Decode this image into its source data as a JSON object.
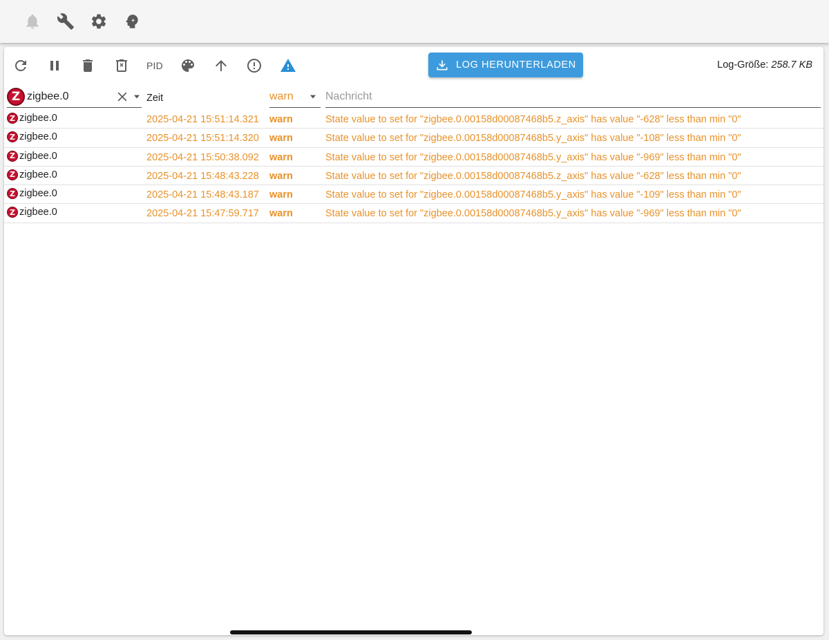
{
  "topbar": {
    "icons": [
      "bell-icon",
      "wrench-icon",
      "gear-icon",
      "head-icon"
    ]
  },
  "toolbar": {
    "pid_label": "PID",
    "download_label": "LOG HERUNTERLADEN",
    "logsize_label": "Log-Größe:",
    "logsize_value": "258.7 KB",
    "accent_color": "#3d9bdd"
  },
  "filters": {
    "source_value": "zigbee.0",
    "time_label": "Zeit",
    "level_value": "warn",
    "message_placeholder": "Nachricht",
    "warn_color": "#e8922b"
  },
  "logs": [
    {
      "source": "zigbee.0",
      "time": "2025-04-21 15:51:14.321",
      "level": "warn",
      "message": "State value to set for \"zigbee.0.00158d00087468b5.z_axis\" has value \"-628\" less than min \"0\""
    },
    {
      "source": "zigbee.0",
      "time": "2025-04-21 15:51:14.320",
      "level": "warn",
      "message": "State value to set for \"zigbee.0.00158d00087468b5.y_axis\" has value \"-108\" less than min \"0\""
    },
    {
      "source": "zigbee.0",
      "time": "2025-04-21 15:50:38.092",
      "level": "warn",
      "message": "State value to set for \"zigbee.0.00158d00087468b5.y_axis\" has value \"-969\" less than min \"0\""
    },
    {
      "source": "zigbee.0",
      "time": "2025-04-21 15:48:43.228",
      "level": "warn",
      "message": "State value to set for \"zigbee.0.00158d00087468b5.z_axis\" has value \"-628\" less than min \"0\""
    },
    {
      "source": "zigbee.0",
      "time": "2025-04-21 15:48:43.187",
      "level": "warn",
      "message": "State value to set for \"zigbee.0.00158d00087468b5.y_axis\" has value \"-109\" less than min \"0\""
    },
    {
      "source": "zigbee.0",
      "time": "2025-04-21 15:47:59.717",
      "level": "warn",
      "message": "State value to set for \"zigbee.0.00158d00087468b5.y_axis\" has value \"-969\" less than min \"0\""
    }
  ]
}
